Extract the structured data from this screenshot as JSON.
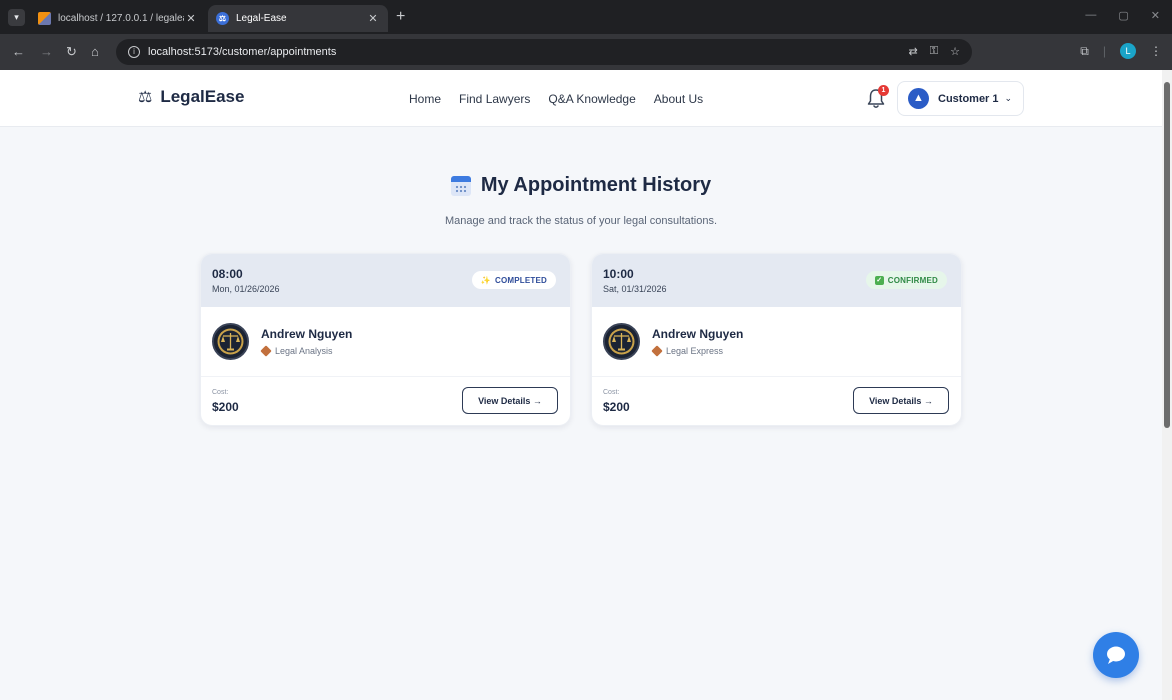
{
  "browser": {
    "tabs": [
      {
        "title": "localhost / 127.0.0.1 / legaleasc",
        "favicon": "phpmyadmin-icon"
      },
      {
        "title": "Legal-Ease",
        "favicon": "legalease-favicon"
      }
    ],
    "url": "localhost:5173/customer/appointments",
    "profile_initial": "L"
  },
  "navbar": {
    "brand": "LegalEase",
    "brand_icon": "⚖",
    "links": [
      "Home",
      "Find Lawyers",
      "Q&A Knowledge",
      "About Us"
    ],
    "notification_count": "1",
    "user_name": "Customer 1"
  },
  "page": {
    "title": "My Appointment History",
    "subtitle": "Manage and track the status of your legal consultations."
  },
  "appointments": [
    {
      "time": "08:00",
      "date": "Mon, 01/26/2026",
      "status": "COMPLETED",
      "lawyer": "Andrew Nguyen",
      "service": "Legal Analysis",
      "cost_label": "Cost:",
      "cost": "$200",
      "action": "View Details →"
    },
    {
      "time": "10:00",
      "date": "Sat, 01/31/2026",
      "status": "CONFIRMED",
      "lawyer": "Andrew Nguyen",
      "service": "Legal Express",
      "cost_label": "Cost:",
      "cost": "$200",
      "action": "View Details →"
    }
  ],
  "colors": {
    "primary": "#1e2a44",
    "accent": "#2f7fe6",
    "completed": "#2f4d9a",
    "confirmed": "#2f8a45",
    "badge_red": "#e53935"
  }
}
